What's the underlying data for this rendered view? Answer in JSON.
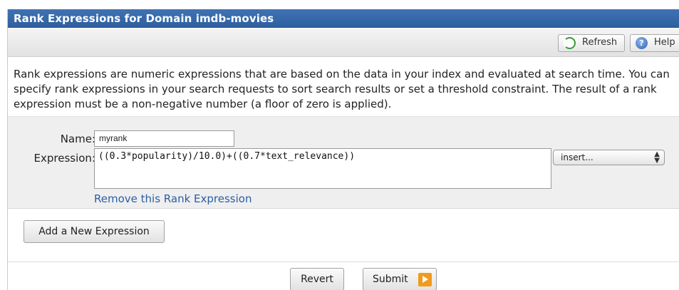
{
  "panel": {
    "title": "Rank Expressions for Domain imdb-movies"
  },
  "toolbar": {
    "refresh_label": "Refresh",
    "refresh_icon": "refresh-icon",
    "help_label": "Help",
    "help_icon": "help-icon"
  },
  "description": "Rank expressions are numeric expressions that are based on the data in your index and evaluated at search time. You can specify rank expressions in your search requests to sort search results or set a threshold constraint. The result of a rank expression must be a non-negative number (a floor of zero is applied).",
  "expression_form": {
    "name_label": "Name:",
    "name_value": "myrank",
    "expression_label": "Expression:",
    "expression_value": "((0.3*popularity)/10.0)+((0.7*text_relevance))",
    "insert_select_value": "insert...",
    "remove_link": "Remove this Rank Expression"
  },
  "add_button": "Add a New Expression",
  "footer": {
    "revert_label": "Revert",
    "submit_label": "Submit",
    "submit_icon": "play-icon"
  },
  "colors": {
    "title_bar": "#3469ab",
    "link": "#2a5ea3",
    "submit_accent": "#f29a1c"
  }
}
